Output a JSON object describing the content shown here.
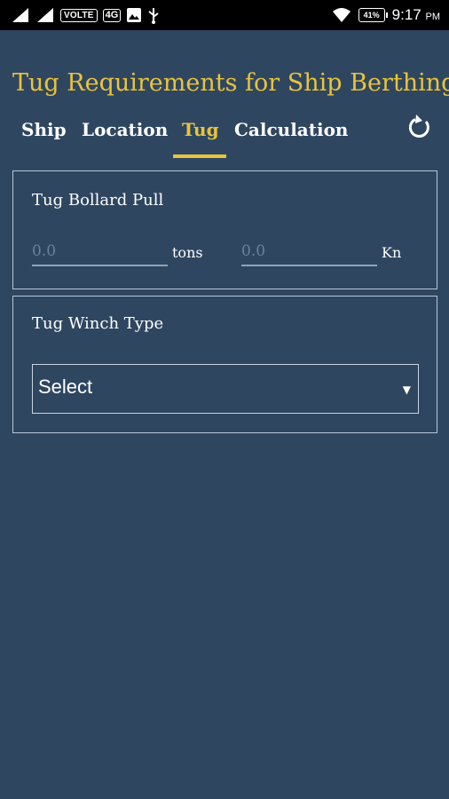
{
  "status_bar": {
    "volte": "VOLTE",
    "lte": "4G",
    "battery": "41%",
    "time": "9:17",
    "ampm": "PM"
  },
  "header": {
    "title": "Tug Requirements for Ship Berthing"
  },
  "tabs": [
    {
      "label": "Ship"
    },
    {
      "label": "Location"
    },
    {
      "label": "Tug",
      "active": true
    },
    {
      "label": "Calculation"
    }
  ],
  "bollard_card": {
    "label": "Tug Bollard Pull",
    "tons_field": {
      "placeholder": "0.0",
      "value": "",
      "unit": "tons"
    },
    "kn_field": {
      "placeholder": "0.0",
      "value": "",
      "unit": "Kn"
    }
  },
  "winch_card": {
    "label": "Tug Winch Type",
    "select_value": "Select"
  },
  "colors": {
    "background": "#2f4660",
    "accent": "#e8c43c",
    "card_border": "#b8c7d8"
  },
  "icons": [
    "signal-icon",
    "wifi-icon",
    "battery-icon",
    "refresh-icon",
    "dropdown-arrow-icon"
  ]
}
